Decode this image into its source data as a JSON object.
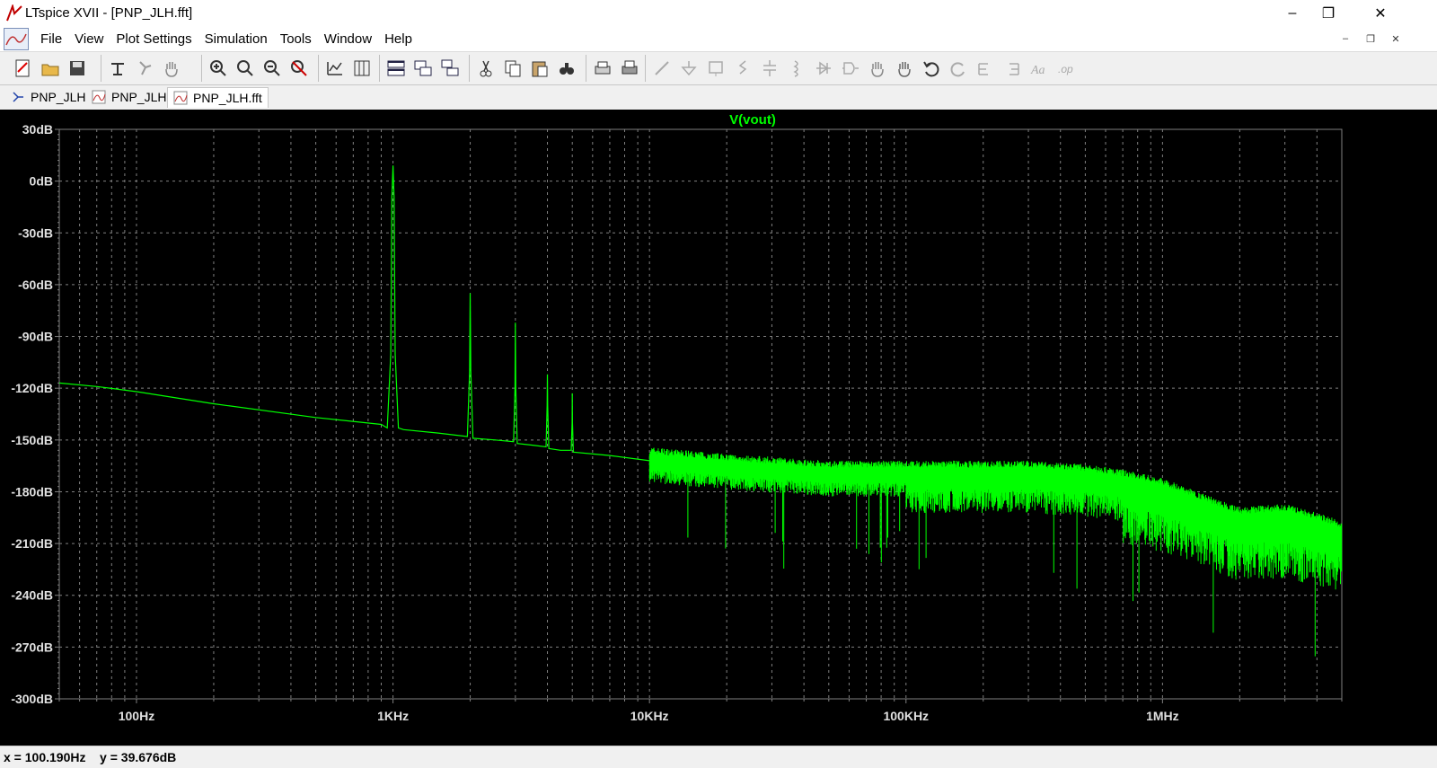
{
  "window": {
    "title": "LTspice XVII - [PNP_JLH.fft]",
    "controls": {
      "minimize": "–",
      "restore": "❐",
      "close": "✕"
    }
  },
  "menu": {
    "items": [
      "File",
      "View",
      "Plot Settings",
      "Simulation",
      "Tools",
      "Window",
      "Help"
    ],
    "mdi_controls": {
      "minimize": "–",
      "restore": "❐",
      "close": "✕"
    }
  },
  "toolbar": {
    "buttons": [
      "new-schematic-icon",
      "open-folder-icon",
      "save-icon",
      "control-panel-icon",
      "run-icon",
      "pan-hand-icon",
      "zoom-in-icon",
      "zoom-area-icon",
      "zoom-out-icon",
      "zoom-cancel-icon",
      "autorange-icon",
      "grid-icon",
      "tile-horizontal-icon",
      "tile-vertical-icon",
      "cascade-icon",
      "cut-icon",
      "copy-icon",
      "paste-icon",
      "find-icon",
      "print-icon",
      "print-setup-icon",
      "wire-icon",
      "ground-icon",
      "label-net-icon",
      "resistor-icon",
      "capacitor-icon",
      "inductor-icon",
      "diode-icon",
      "component-icon",
      "move-icon",
      "drag-icon",
      "undo-icon",
      "redo-icon",
      "rotate-icon",
      "mirror-icon",
      "text-icon",
      "spice-directive-icon"
    ]
  },
  "tabs": [
    {
      "label": "PNP_JLH",
      "icon": "schematic-icon"
    },
    {
      "label": "PNP_JLH",
      "icon": "waveform-icon"
    },
    {
      "label": "PNP_JLH.fft",
      "icon": "waveform-icon"
    }
  ],
  "plot": {
    "trace_name": "V(vout)",
    "y_ticks": [
      "30dB",
      "0dB",
      "-30dB",
      "-60dB",
      "-90dB",
      "-120dB",
      "-150dB",
      "-180dB",
      "-210dB",
      "-240dB",
      "-270dB",
      "-300dB"
    ],
    "x_ticks": [
      "100Hz",
      "1KHz",
      "10KHz",
      "100KHz",
      "1MHz"
    ],
    "colors": {
      "background": "#000000",
      "trace": "#00ff00",
      "grid": "#808080",
      "axis_text": "#e0e0e0",
      "title": "#00ff00"
    }
  },
  "chart_data": {
    "type": "line",
    "title": "V(vout)",
    "xlabel": "",
    "ylabel": "",
    "x_scale": "log",
    "xlim": [
      50,
      5000000
    ],
    "ylim": [
      -300,
      30
    ],
    "x_unit": "Hz",
    "y_unit": "dB",
    "grid": true,
    "series": [
      {
        "name": "V(vout)",
        "x": [
          50,
          70,
          100,
          200,
          500,
          900,
          950,
          980,
          990,
          1000,
          1010,
          1020,
          1050,
          1100,
          1500,
          1950,
          1990,
          2000,
          2010,
          2050,
          2500,
          2950,
          2990,
          3000,
          3010,
          3050,
          3500,
          3950,
          3990,
          4000,
          4010,
          4050,
          4500,
          4950,
          4990,
          5000,
          5010,
          5050,
          7000,
          10000,
          20000,
          50000,
          100000,
          200000,
          300000,
          500000,
          700000,
          1000000,
          1500000,
          2000000,
          3000000,
          4000000,
          5000000
        ],
        "y": [
          -117,
          -119,
          -122,
          -129,
          -137,
          -141,
          -143,
          -100,
          -10,
          9,
          -10,
          -100,
          -143,
          -144,
          -146,
          -148,
          -110,
          -65,
          -110,
          -149,
          -150,
          -151,
          -120,
          -82,
          -120,
          -152,
          -153,
          -154,
          -130,
          -112,
          -130,
          -155,
          -156,
          -156,
          -140,
          -123,
          -140,
          -157,
          -159,
          -162,
          -166,
          -170,
          -170,
          -170,
          -170,
          -172,
          -175,
          -180,
          -190,
          -197,
          -195,
          -200,
          -205
        ]
      }
    ],
    "cursor_readout": {
      "x": "100.190Hz",
      "y": "39.676dB"
    }
  },
  "status": {
    "x_label": "x =",
    "x_value": "100.190Hz",
    "y_label": "y =",
    "y_value": "39.676dB"
  }
}
